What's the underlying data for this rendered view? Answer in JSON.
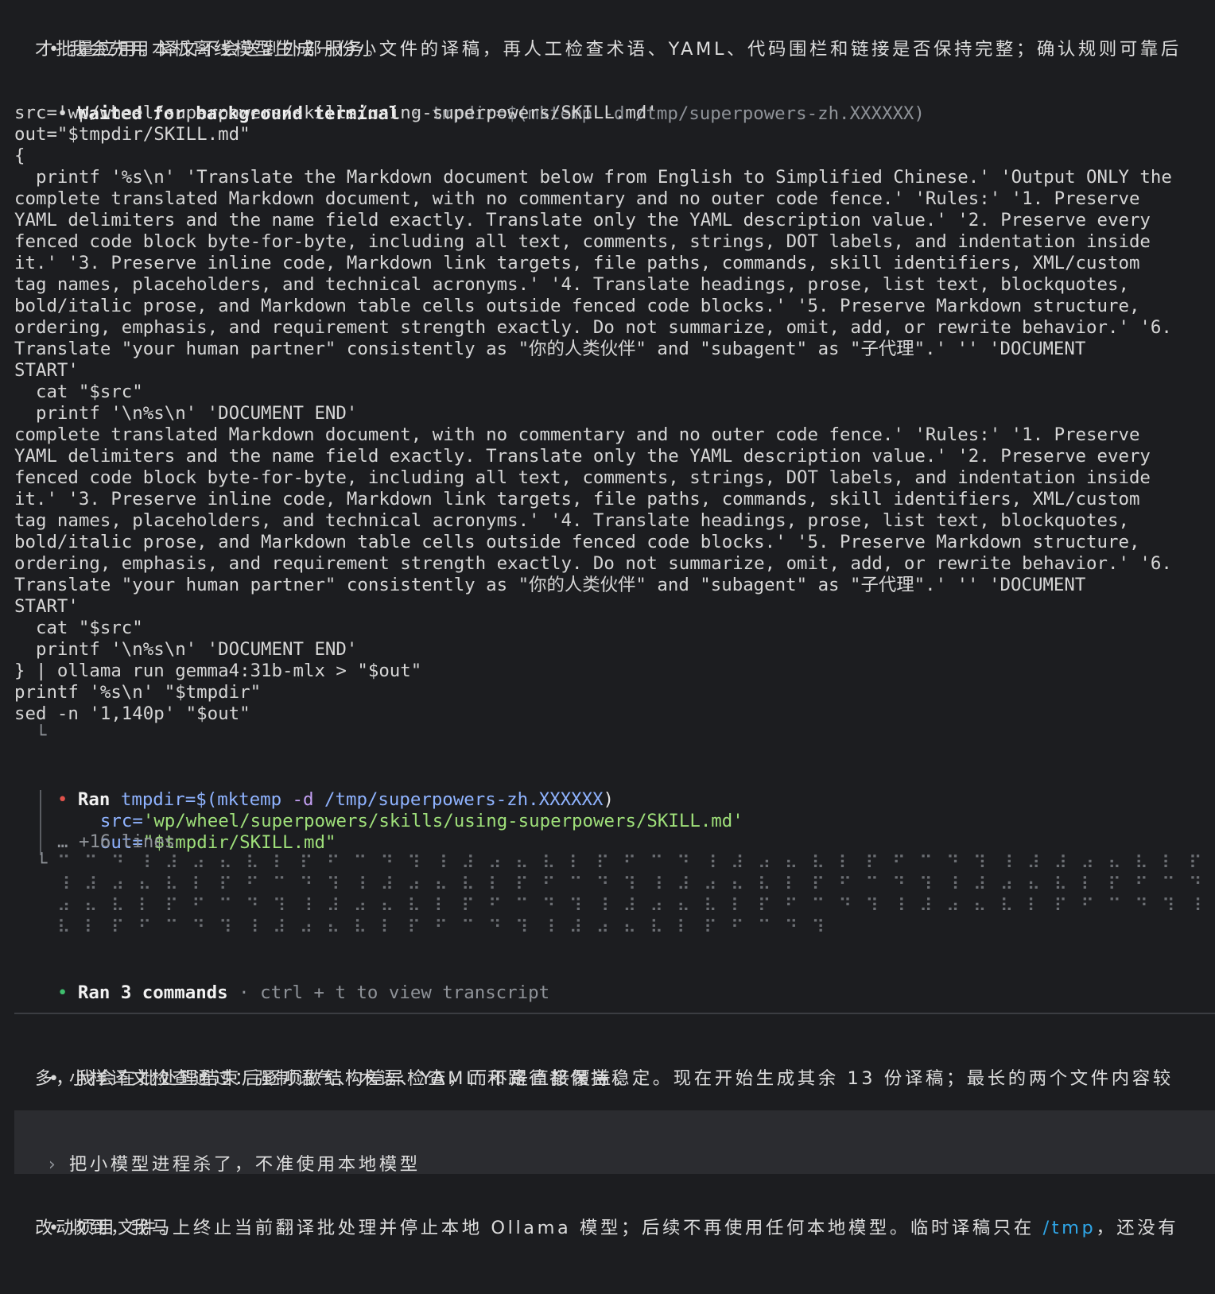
{
  "message1": {
    "bullet": "•",
    "line1": "我会先用本机离线模型生成一份小文件的译稿，再人工检查术语、YAML、代码围栏和链接是否保持完整；确认规则可靠后",
    "line2": "才批量应用。译文不会送到外部服务。"
  },
  "waited": {
    "bullet": "•",
    "label": "Waited for background terminal",
    "sep": " · ",
    "command_first": "tmpdir=$(mktemp -d /tmp/superpowers-zh.XXXXXX)",
    "lines": [
      "src='wp/wheel/superpowers/skills/using-superpowers/SKILL.md'",
      "out=\"$tmpdir/SKILL.md\"",
      "{",
      "  printf '%s\\n' 'Translate the Markdown document below from English to Simplified Chinese.' 'Output ONLY the",
      "complete translated Markdown document, with no commentary and no outer code fence.' 'Rules:' '1. Preserve",
      "YAML delimiters and the name field exactly. Translate only the YAML description value.' '2. Preserve every",
      "fenced code block byte-for-byte, including all text, comments, strings, DOT labels, and indentation inside",
      "it.' '3. Preserve inline code, Markdown link targets, file paths, commands, skill identifiers, XML/custom",
      "tag names, placeholders, and technical acronyms.' '4. Translate headings, prose, list text, blockquotes,",
      "bold/italic prose, and Markdown table cells outside fenced code blocks.' '5. Preserve Markdown structure,",
      "ordering, emphasis, and requirement strength exactly. Do not summarize, omit, add, or rewrite behavior.' '6.",
      "Translate \"your human partner\" consistently as \"你的人类伙伴\" and \"subagent\" as \"子代理\".' '' 'DOCUMENT",
      "START'",
      "  cat \"$src\"",
      "  printf '\\n%s\\n' 'DOCUMENT END'",
      "complete translated Markdown document, with no commentary and no outer code fence.' 'Rules:' '1. Preserve",
      "YAML delimiters and the name field exactly. Translate only the YAML description value.' '2. Preserve every",
      "fenced code block byte-for-byte, including all text, comments, strings, DOT labels, and indentation inside",
      "it.' '3. Preserve inline code, Markdown link targets, file paths, commands, skill identifiers, XML/custom",
      "tag names, placeholders, and technical acronyms.' '4. Translate headings, prose, list text, blockquotes,",
      "bold/italic prose, and Markdown table cells outside fenced code blocks.' '5. Preserve Markdown structure,",
      "ordering, emphasis, and requirement strength exactly. Do not summarize, omit, add, or rewrite behavior.' '6.",
      "Translate \"your human partner\" consistently as \"你的人类伙伴\" and \"subagent\" as \"子代理\".' '' 'DOCUMENT",
      "START'",
      "  cat \"$src\"",
      "  printf '\\n%s\\n' 'DOCUMENT END'",
      "} | ollama run gemma4:31b-mlx > \"$out\"",
      "printf '%s\\n' \"$tmpdir\"",
      "sed -n '1,140p' \"$out\""
    ],
    "tail": "  └"
  },
  "ran": {
    "bullet": "•",
    "label": "Ran",
    "cmd1_a": "tmpdir=$(",
    "cmd1_b": "mktemp",
    "cmd1_c": " -d",
    "cmd1_d": " /tmp/superpowers-zh.XXXXXX",
    "cmd1_e": ")",
    "src_a": "src=",
    "src_b": "'wp/wheel/superpowers/skills/using-superpowers/SKILL.md'",
    "out_a": "out=",
    "out_b": "\"$tmpdir/SKILL.md\"",
    "more": "… +16 lines",
    "braille1": "⠉ ⠉ ⠙ ⠸ ⠼ ⠴ ⠦ ⠧ ⠇ ⠏ ⠋ ⠉ ⠙ ⠹ ⠸ ⠼ ⠴ ⠦ ⠧ ⠇ ⠏ ⠋ ⠉ ⠙ ⠸ ⠼ ⠴ ⠦ ⠧ ⠇ ⠏ ⠋ ⠉ ⠙ ⠹ ⠸ ⠼ ⠼ ⠴ ⠦ ⠧ ⠇ ⠏ ⠋ ⠉ ⠙ ⠹ ⠸ ⠼ ⠴ ⠴ ⠦ ⠧ ⠇ ⠏ ⠋ ⠉",
    "braille2": "⠸ ⠼ ⠴ ⠦ ⠧ ⠇ ⠏ ⠋ ⠉ ⠙ ⠹ ⠸ ⠼ ⠴ ⠦ ⠧ ⠇ ⠏ ⠋ ⠉ ⠙ ⠹ ⠸ ⠼ ⠴ ⠦ ⠧ ⠇ ⠏ ⠋ ⠉ ⠙ ⠹ ⠸ ⠼ ⠴ ⠦ ⠧ ⠇ ⠏ ⠋ ⠉ ⠙ ⠹ ⠸ ⠼ ⠴ ⠦ ⠧ ⠇ ⠏ ⠋ ⠉ ⠙ ⠹ ⠸ ⠼",
    "braille3": "⠴ ⠦ ⠧ ⠇ ⠏ ⠋ ⠉ ⠙ ⠹ ⠸ ⠼ ⠴ ⠦ ⠧ ⠇ ⠏ ⠋ ⠉ ⠙ ⠹ ⠸ ⠼ ⠴ ⠦ ⠧ ⠇ ⠏ ⠋ ⠉ ⠙ ⠹ ⠸ ⠼ ⠴ ⠦ ⠧ ⠇ ⠏ ⠋ ⠉ ⠙ ⠹ ⠸ ⠼ ⠴ ⠦ ⠧ ⠇ ⠏ ⠋ ⠉ ⠙ ⠹ ⠸ ⠼ ⠴ ⠦",
    "braille4": "⠧ ⠇ ⠏ ⠋ ⠉ ⠙ ⠹ ⠸ ⠼ ⠴ ⠦ ⠧ ⠇ ⠏ ⠋ ⠉ ⠙ ⠹ ⠸ ⠼ ⠴ ⠦ ⠧ ⠇ ⠏ ⠋ ⠉ ⠙ ⠹"
  },
  "ran3": {
    "bullet": "•",
    "label": "Ran 3 commands",
    "sep": " · ",
    "hint": "ctrl + t to view transcript"
  },
  "message2": {
    "bullet": "•",
    "line1": "小样译文检查通过：强制语气、术语、YAML 和路径都保持稳定。现在开始生成其余 13 份译稿；最长的两个文件内容较",
    "line2": "多，我会在批处理结束后逐项做结构差异检查，而不是直接覆盖。"
  },
  "user_prompt": {
    "chevron": "›",
    "text": "把小模型进程杀了，不准使用本地模型"
  },
  "message3": {
    "bullet": "•",
    "line1_a": "收到，我马上终止当前翻译批处理并停止本地 Ollama 模型；后续不再使用任何本地模型。临时译稿只在 ",
    "line1_link": "/tmp",
    "line1_b": "，还没有",
    "line2": "改动项目文件。"
  },
  "colors": {
    "background": "#1c1d20",
    "dim_text": "#8f9399",
    "red_bullet": "#e0524b",
    "green_bullet": "#3fbf6e",
    "link": "#2fa6e8",
    "prompt_bg": "#2b2c30"
  }
}
